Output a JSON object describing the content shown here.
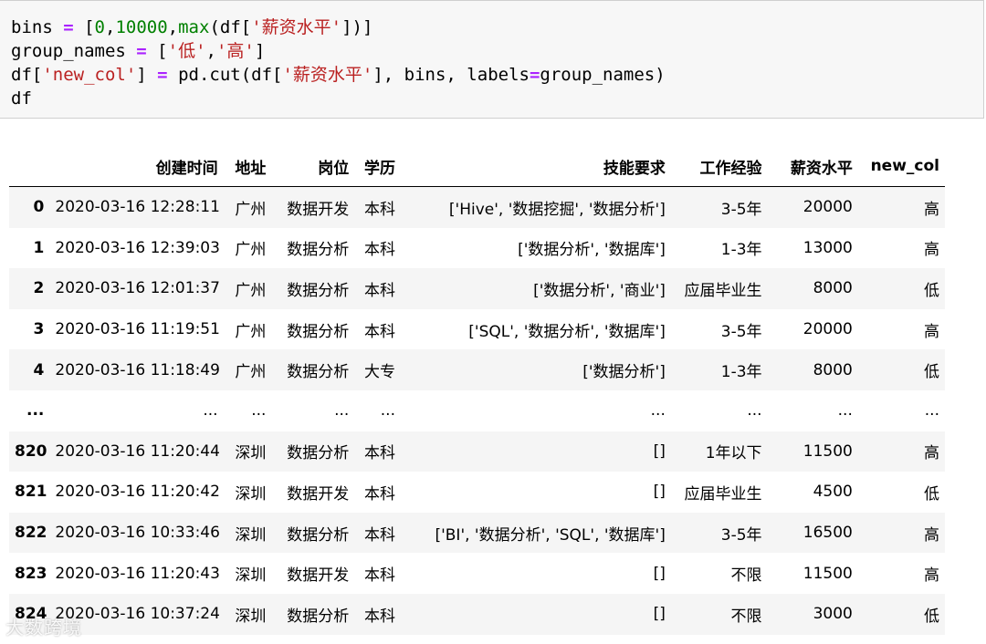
{
  "code_cell": {
    "lines": [
      [
        [
          "t",
          "bins "
        ],
        [
          "op",
          "="
        ],
        [
          "t",
          " ["
        ],
        [
          "num",
          "0"
        ],
        [
          "t",
          ","
        ],
        [
          "num",
          "10000"
        ],
        [
          "t",
          ","
        ],
        [
          "bi",
          "max"
        ],
        [
          "t",
          "(df["
        ],
        [
          "str",
          "'薪资水平'"
        ],
        [
          "t",
          "])]"
        ]
      ],
      [
        [
          "t",
          "group_names "
        ],
        [
          "op",
          "="
        ],
        [
          "t",
          " ["
        ],
        [
          "str",
          "'低'"
        ],
        [
          "t",
          ","
        ],
        [
          "str",
          "'高'"
        ],
        [
          "t",
          "]"
        ]
      ],
      [
        [
          "t",
          "df["
        ],
        [
          "str",
          "'new_col'"
        ],
        [
          "t",
          "] "
        ],
        [
          "op",
          "="
        ],
        [
          "t",
          " pd.cut(df["
        ],
        [
          "str",
          "'薪资水平'"
        ],
        [
          "t",
          "], bins, labels"
        ],
        [
          "op",
          "="
        ],
        [
          "t",
          "group_names)"
        ]
      ],
      [
        [
          "t",
          "df"
        ]
      ]
    ]
  },
  "table": {
    "columns": [
      "",
      "创建时间",
      "地址",
      "岗位",
      "学历",
      "技能要求",
      "工作经验",
      "薪资水平",
      "new_col"
    ],
    "rows": [
      [
        "0",
        "2020-03-16 12:28:11",
        "广州",
        "数据开发",
        "本科",
        "['Hive', '数据挖掘', '数据分析']",
        "3-5年",
        "20000",
        "高"
      ],
      [
        "1",
        "2020-03-16 12:39:03",
        "广州",
        "数据分析",
        "本科",
        "['数据分析', '数据库']",
        "1-3年",
        "13000",
        "高"
      ],
      [
        "2",
        "2020-03-16 12:01:37",
        "广州",
        "数据分析",
        "本科",
        "['数据分析', '商业']",
        "应届毕业生",
        "8000",
        "低"
      ],
      [
        "3",
        "2020-03-16 11:19:51",
        "广州",
        "数据分析",
        "本科",
        "['SQL', '数据分析', '数据库']",
        "3-5年",
        "20000",
        "高"
      ],
      [
        "4",
        "2020-03-16 11:18:49",
        "广州",
        "数据分析",
        "大专",
        "['数据分析']",
        "1-3年",
        "8000",
        "低"
      ],
      [
        "...",
        "...",
        "...",
        "...",
        "...",
        "...",
        "...",
        "...",
        "..."
      ],
      [
        "820",
        "2020-03-16 11:20:44",
        "深圳",
        "数据分析",
        "本科",
        "[]",
        "1年以下",
        "11500",
        "高"
      ],
      [
        "821",
        "2020-03-16 11:20:42",
        "深圳",
        "数据开发",
        "本科",
        "[]",
        "应届毕业生",
        "4500",
        "低"
      ],
      [
        "822",
        "2020-03-16 10:33:46",
        "深圳",
        "数据分析",
        "本科",
        "['BI', '数据分析', 'SQL', '数据库']",
        "3-5年",
        "16500",
        "高"
      ],
      [
        "823",
        "2020-03-16 11:20:43",
        "深圳",
        "数据开发",
        "本科",
        "[]",
        "不限",
        "11500",
        "高"
      ],
      [
        "824",
        "2020-03-16 10:37:24",
        "深圳",
        "数据分析",
        "本科",
        "[]",
        "不限",
        "3000",
        "低"
      ]
    ]
  },
  "watermark": "大数跨境",
  "colors": {
    "string": "#ba2121",
    "number": "#008000",
    "operator": "#aa22ff",
    "code_bg": "#f7f7f7",
    "row_stripe": "#f5f5f5"
  }
}
